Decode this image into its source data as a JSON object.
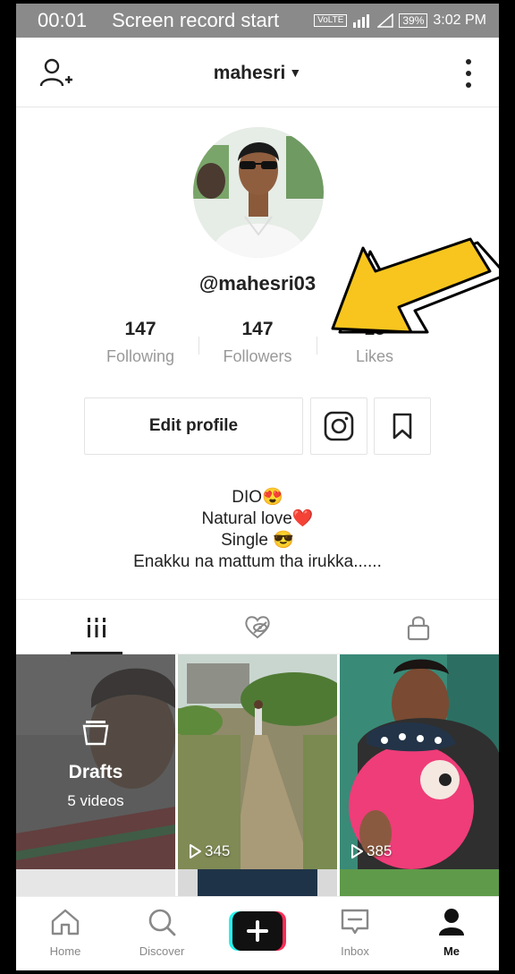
{
  "status_bar": {
    "record_time": "00:01",
    "record_text": "Screen record start",
    "volte": "VoLTE",
    "battery": "39%",
    "clock": "3:02 PM"
  },
  "header": {
    "username": "mahesri"
  },
  "profile": {
    "handle": "@mahesri03",
    "stats": [
      {
        "value": "147",
        "label": "Following"
      },
      {
        "value": "147",
        "label": "Followers"
      },
      {
        "value": "15",
        "label": "Likes"
      }
    ],
    "edit_label": "Edit profile",
    "bio": [
      "DIO😍",
      "Natural love❤️",
      "Single 😎",
      "Enakku na mattum tha irukka......"
    ]
  },
  "grid": {
    "drafts_label": "Drafts",
    "drafts_count": "5 videos",
    "videos": [
      {
        "views": "345"
      },
      {
        "views": "385"
      }
    ]
  },
  "bottom_nav": [
    {
      "label": "Home"
    },
    {
      "label": "Discover"
    },
    {
      "label": "Inbox"
    },
    {
      "label": "Me"
    }
  ],
  "colors": {
    "accent_cyan": "#25f4ee",
    "accent_pink": "#fe2c55",
    "arrow_yellow": "#f7c51e"
  }
}
